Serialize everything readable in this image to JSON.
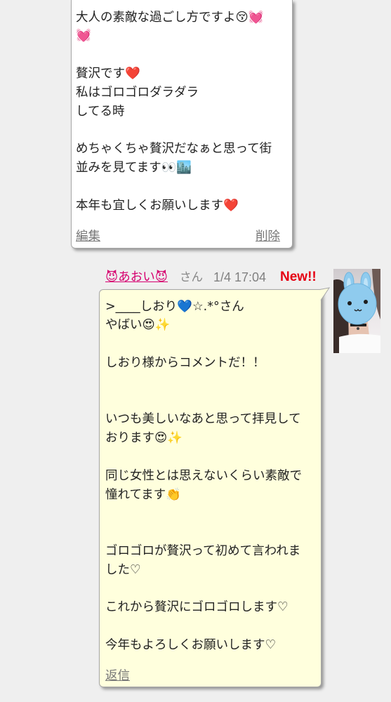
{
  "colors": {
    "page_background": "#efefef",
    "own_bubble": "#ffffff",
    "reply_bubble": "#ffffdd",
    "bubble_border": "#a8a8a8",
    "author_link": "#d6006f",
    "meta_text": "#888888",
    "new_badge": "#e60012",
    "action_link": "#777777",
    "body_text": "#222222"
  },
  "top_comment": {
    "lines": [
      "大人の素敵な過ごし方ですよ😚💓",
      "💓",
      "",
      "贅沢です❤️",
      "私はゴロゴロダラダラ",
      "してる時",
      "",
      "めちゃくちゃ贅沢だなぁと思って街",
      "並みを見てます👀🏙️",
      "",
      "本年も宜しくお願いします❤️"
    ],
    "edit_label": "編集",
    "delete_label": "削除"
  },
  "reply": {
    "author_name": "😈あおい😈",
    "honorific": "さん",
    "timestamp": "1/4 17:04",
    "new_badge": "New!!",
    "lines": [
      ">____しおり💙☆.*°さん",
      "やばい😍✨",
      "",
      "しおり様からコメントだ！！",
      "",
      "",
      "いつも美しいなあと思って拝見して",
      "おります😍✨",
      "",
      "同じ女性とは思えないくらい素敵で",
      "憧れてます👏",
      "",
      "",
      "ゴロゴロが贅沢って初めて言われま",
      "した♡",
      "",
      "これから贅沢にゴロゴロします♡",
      "",
      "今年もよろしくお願いします♡"
    ],
    "reply_label": "返信"
  }
}
